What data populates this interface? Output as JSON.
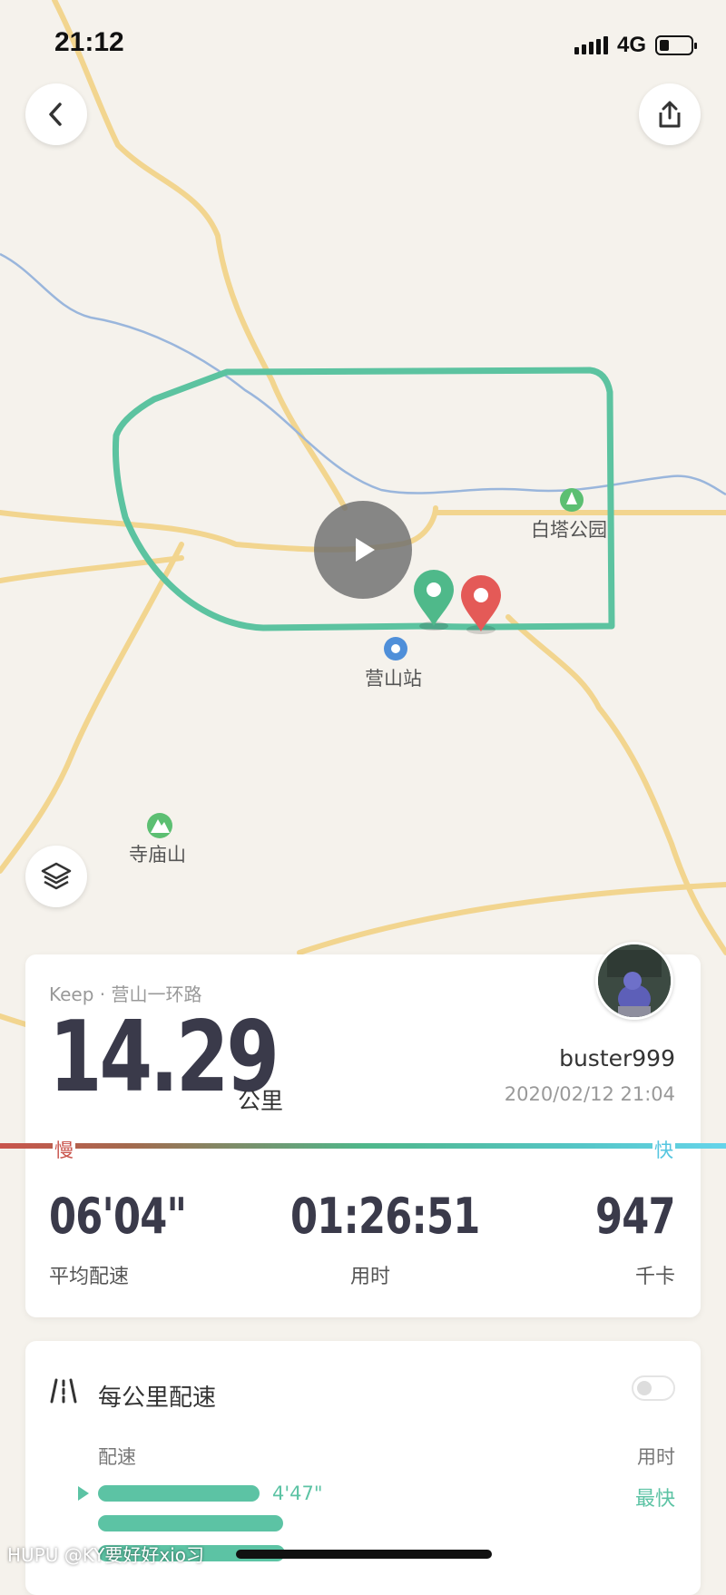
{
  "status_bar": {
    "time": "21:12",
    "network": "4G",
    "battery_level": 0.3
  },
  "map": {
    "labels": {
      "park": "白塔公园",
      "station": "营山站",
      "mountain": "寺庙山"
    },
    "colors": {
      "route": "#5cc3a0",
      "start_pin": "#4fb98a",
      "end_pin": "#e45a57",
      "road": "#f2d58f",
      "river": "#9ab6dc"
    }
  },
  "controls": {
    "back_icon": "chevron-left-icon",
    "share_icon": "share-icon",
    "layers_icon": "layers-icon",
    "play_icon": "play-icon"
  },
  "summary": {
    "source": "Keep · 营山一环路",
    "distance": "14.29",
    "distance_unit": "公里",
    "username": "buster999",
    "datetime": "2020/02/12 21:04",
    "speed_slow": "慢",
    "speed_fast": "快",
    "stats": {
      "avg_pace": {
        "value": "06'04\"",
        "label": "平均配速"
      },
      "duration": {
        "value": "01:26:51",
        "label": "用时"
      },
      "calories": {
        "value": "947",
        "label": "千卡"
      }
    }
  },
  "pace_card": {
    "title": "每公里配速",
    "col_pace": "配速",
    "col_time": "用时",
    "first_pace": "4'47\"",
    "fastest_label": "最快"
  },
  "watermark": "HUPU @KY要好好xio习"
}
